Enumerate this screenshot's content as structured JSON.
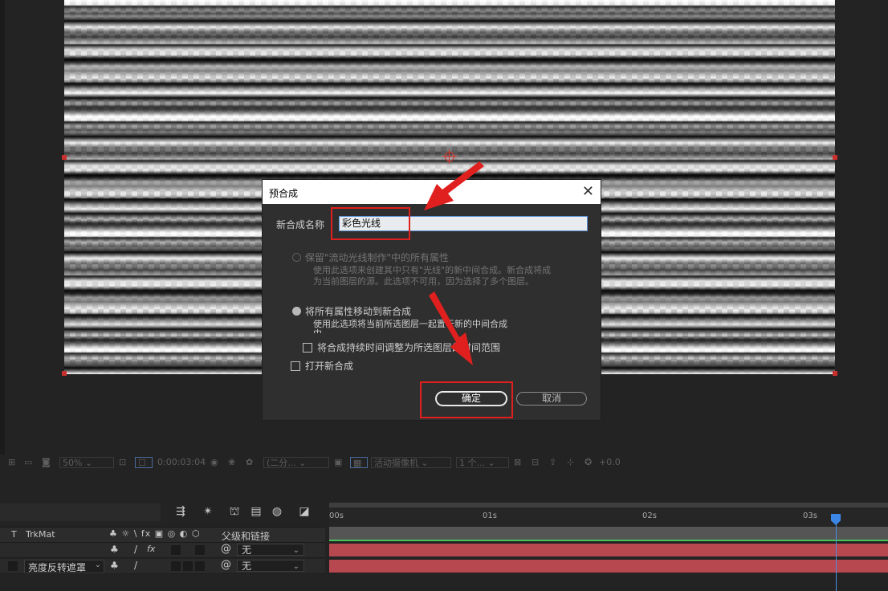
{
  "viewer_toolbar": {
    "zoom": "50%",
    "timecode": "0:00:03:04",
    "resolution": "(二分...",
    "camera": "活动摄像机",
    "views": "1 个...",
    "exposure": "+0.0"
  },
  "timeline": {
    "ruler_labels": [
      "00s",
      "01s",
      "02s",
      "03s"
    ],
    "col_trkmat": "TrkMat",
    "col_t": "T",
    "col_parent": "父级和链接",
    "switch_glyphs": "♣ ☼ \\ fx ▣ ◎ ◐ ⬡",
    "rows": [
      {
        "trkmat": "",
        "parent": "无"
      },
      {
        "trkmat": "亮度反转遮罩",
        "parent": "无"
      }
    ]
  },
  "dialog": {
    "title": "预合成",
    "close": "✕",
    "name_label": "新合成名称",
    "name_value": "彩色光线",
    "option1_label": "保留\"流动光线制作\"中的所有属性",
    "option1_desc_line1": "使用此选项来创建其中只有\"光线\"的新中间合成。新合成将成",
    "option1_desc_line2": "为当前图层的源。此选项不可用，因为选择了多个图层。",
    "option2_label": "将所有属性移动到新合成",
    "option2_desc_line1": "使用此选项将当前所选图层一起置于新的中间合成",
    "option2_desc_line2": "中。",
    "adjust_duration_label": "将合成持续时间调整为所选图层的时间范围",
    "open_new_comp_label": "打开新合成",
    "ok_label": "确定",
    "cancel_label": "取消",
    "selected_option": "option2"
  },
  "colors": {
    "annotation_red": "#e0201e",
    "layer_bar": "#b8484f",
    "playhead": "#3c86e6"
  }
}
